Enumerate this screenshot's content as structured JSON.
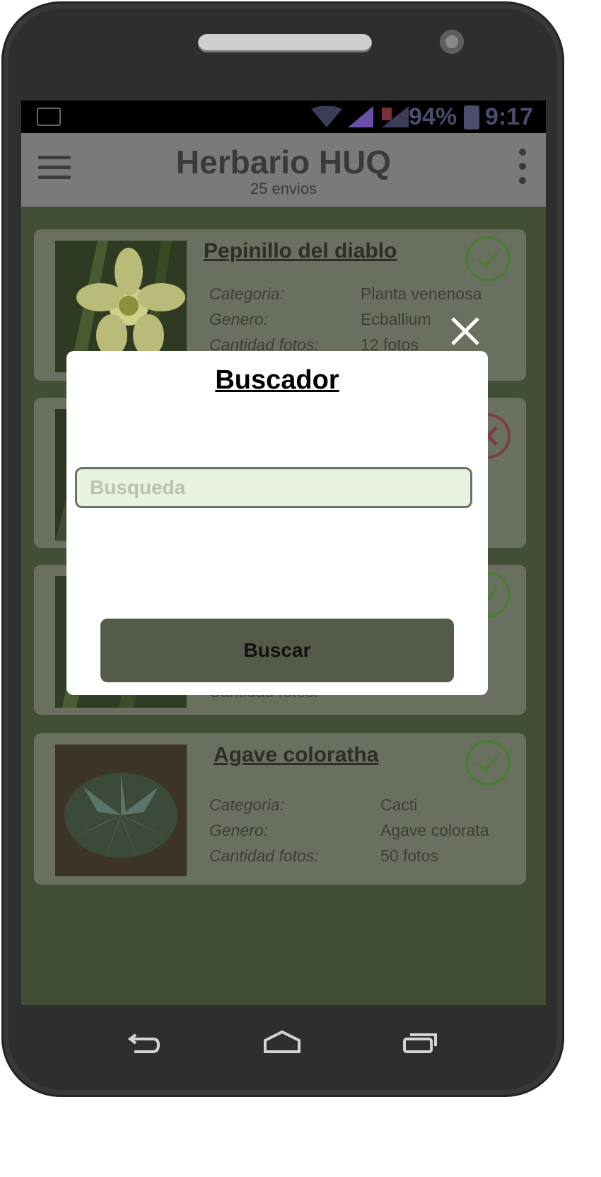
{
  "status_bar": {
    "battery": "94%",
    "time": "9:17",
    "icons": [
      "gallery-icon",
      "wifi-icon",
      "signal-icon",
      "signal-roaming-icon",
      "battery-icon"
    ]
  },
  "app_bar": {
    "title": "Herbario HUQ",
    "subtitle": "25 envios",
    "menu_icon": "hamburger-menu-icon",
    "more_icon": "overflow-menu-icon"
  },
  "cards": [
    {
      "name": "Pepinillo del diablo",
      "labels": [
        "Categoria:",
        "Genero:",
        "Cantidad fotos:"
      ],
      "values": [
        "Planta venenosa",
        "Ecballium",
        "12 fotos"
      ],
      "status": "approved"
    },
    {
      "name": "",
      "labels": [],
      "values": [],
      "status": "rejected"
    },
    {
      "name": "",
      "labels": [
        "Cantidad fotos:"
      ],
      "values": [],
      "status": "approved"
    },
    {
      "name": "Agave coloratha",
      "labels": [
        "Categoria:",
        "Genero:",
        "Cantidad fotos:"
      ],
      "values": [
        "Cacti",
        "Agave colorata",
        "50 fotos"
      ],
      "status": "approved"
    }
  ],
  "dialog": {
    "title": "Buscador",
    "search_placeholder": "Busqueda",
    "search_value": "",
    "button_label": "Buscar",
    "close_icon": "close-icon"
  },
  "nav": {
    "icons": [
      "back-icon",
      "home-icon",
      "recent-apps-icon"
    ]
  },
  "colors": {
    "screen_bg": "#434e37",
    "card_bg": "#6a705f",
    "button_bg": "#545c49",
    "input_bg": "#e8f2df",
    "approved": "#4f7a3c",
    "rejected": "#7a4040"
  }
}
